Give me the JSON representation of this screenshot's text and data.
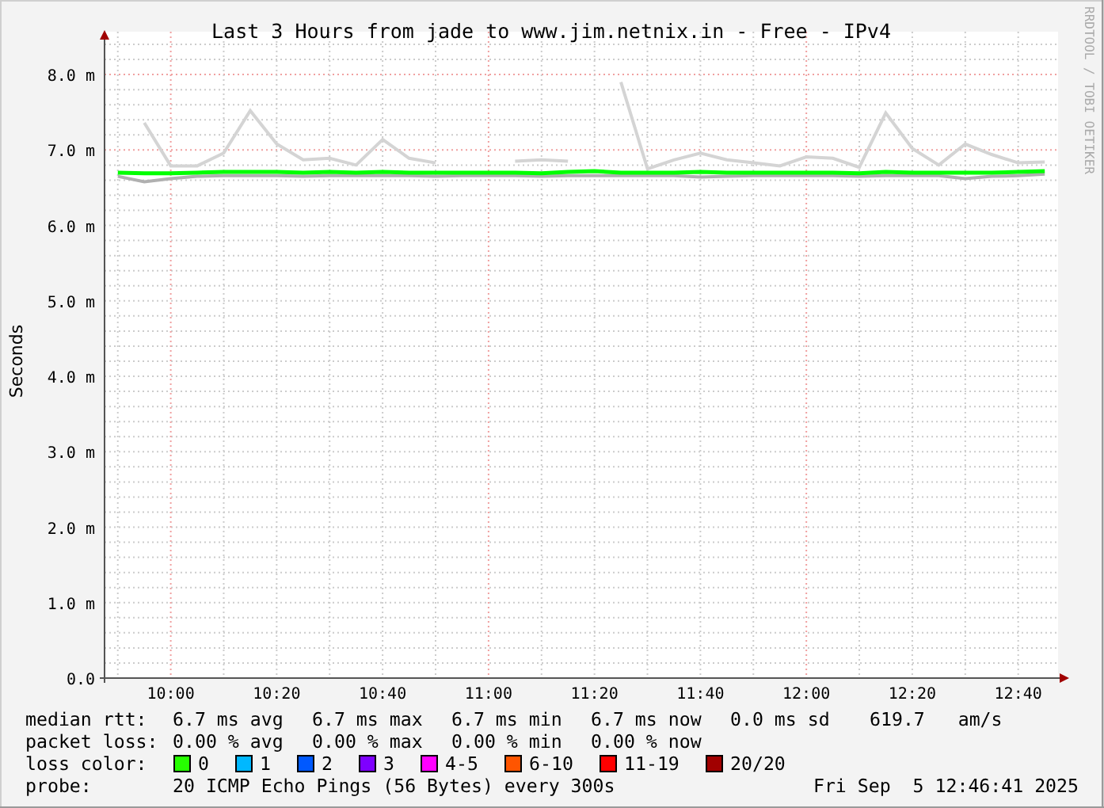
{
  "chart": {
    "credit": "RRDTOOL / TOBI OETIKER",
    "chart_data": {
      "type": "line",
      "title": "Last 3 Hours from jade to www.jim.netnix.in - Free - IPv4",
      "ylabel": "Seconds",
      "categories": [
        null,
        null,
        "10:00",
        null,
        null,
        null,
        "10:20",
        null,
        null,
        null,
        "10:40",
        null,
        null,
        null,
        "11:00",
        null,
        null,
        null,
        "11:20",
        null,
        null,
        null,
        "11:40",
        null,
        null,
        null,
        "12:00",
        null,
        null,
        null,
        "12:20",
        null,
        null,
        null,
        "12:40",
        null
      ],
      "ylim": [
        0,
        8.4
      ],
      "grid": true,
      "yticks": [
        {
          "value": 0,
          "label": "0.0"
        },
        {
          "value": 1,
          "label": "1.0 m"
        },
        {
          "value": 2,
          "label": "2.0 m"
        },
        {
          "value": 3,
          "label": "3.0 m"
        },
        {
          "value": 4,
          "label": "4.0 m"
        },
        {
          "value": 5,
          "label": "5.0 m"
        },
        {
          "value": 6,
          "label": "6.0 m"
        },
        {
          "value": 7,
          "label": "7.0 m"
        },
        {
          "value": 8,
          "label": "8.0 m"
        }
      ],
      "series": [
        {
          "color": "#d4d4d4",
          "values": [
            null,
            7.36,
            6.79,
            6.79,
            6.96,
            7.52,
            7.08,
            6.87,
            6.89,
            6.8,
            7.14,
            6.89,
            6.83,
            null,
            null,
            6.85,
            6.87,
            6.85,
            null,
            7.9,
            6.75,
            6.87,
            6.96,
            6.87,
            6.83,
            6.79,
            6.91,
            6.89,
            6.77,
            7.49,
            7.02,
            6.8,
            7.08,
            6.94,
            6.83,
            6.84
          ]
        },
        {
          "color": "#b0b0b0",
          "values": [
            6.65,
            6.58,
            6.62,
            6.65,
            6.66,
            6.66,
            6.66,
            6.65,
            6.66,
            6.66,
            6.66,
            6.66,
            6.65,
            6.66,
            6.66,
            6.66,
            6.65,
            6.66,
            6.66,
            6.66,
            6.66,
            6.66,
            6.64,
            6.65,
            6.66,
            6.66,
            6.66,
            6.66,
            6.65,
            6.66,
            6.66,
            6.66,
            6.62,
            6.65,
            6.66,
            6.68
          ]
        },
        {
          "color": "#00ff00",
          "values": [
            6.7,
            6.69,
            6.69,
            6.7,
            6.71,
            6.71,
            6.71,
            6.7,
            6.71,
            6.7,
            6.71,
            6.7,
            6.7,
            6.7,
            6.7,
            6.7,
            6.69,
            6.71,
            6.72,
            6.7,
            6.7,
            6.7,
            6.71,
            6.7,
            6.7,
            6.7,
            6.7,
            6.7,
            6.69,
            6.71,
            6.7,
            6.7,
            6.7,
            6.7,
            6.71,
            6.72
          ]
        }
      ]
    }
  },
  "legend": {
    "median_rtt": {
      "label": "median rtt:",
      "values": [
        "6.7 ms avg",
        "6.7 ms max",
        "6.7 ms min",
        "6.7 ms now",
        "0.0 ms sd",
        "619.7   am/s"
      ]
    },
    "packet_loss": {
      "label": "packet loss:",
      "values": [
        "0.00 % avg",
        "0.00 % max",
        "0.00 % min",
        "0.00 % now"
      ]
    },
    "loss_colors": {
      "label": "loss color:",
      "items": [
        {
          "label": "0",
          "color": "#26ff00"
        },
        {
          "label": "1",
          "color": "#00b8ff"
        },
        {
          "label": "2",
          "color": "#0059ff"
        },
        {
          "label": "3",
          "color": "#7e00ff"
        },
        {
          "label": "4-5",
          "color": "#ff00ff"
        },
        {
          "label": "6-10",
          "color": "#ff5500"
        },
        {
          "label": "11-19",
          "color": "#ff0000"
        },
        {
          "label": "20/20",
          "color": "#a10000"
        }
      ]
    },
    "probe": {
      "label": "probe:",
      "value": "20 ICMP Echo Pings (56 Bytes) every 300s",
      "timestamp": "Fri Sep  5 12:46:41 2025"
    }
  }
}
